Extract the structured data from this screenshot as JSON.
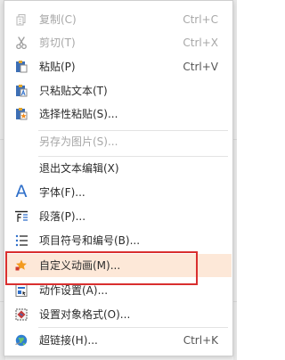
{
  "context_menu": {
    "items": [
      {
        "id": "copy",
        "label": "复制(C)",
        "shortcut": "Ctrl+C",
        "icon": "copy-icon",
        "enabled": false
      },
      {
        "id": "cut",
        "label": "剪切(T)",
        "shortcut": "Ctrl+X",
        "icon": "scissors-icon",
        "enabled": false
      },
      {
        "id": "paste",
        "label": "粘贴(P)",
        "shortcut": "Ctrl+V",
        "icon": "clipboard-paste-icon",
        "enabled": true
      },
      {
        "id": "paste-text-only",
        "label": "只粘贴文本(T)",
        "shortcut": "",
        "icon": "paste-text-icon",
        "enabled": true
      },
      {
        "id": "paste-special",
        "label": "选择性粘贴(S)...",
        "shortcut": "",
        "icon": "paste-special-icon",
        "enabled": true
      },
      {
        "id": "save-as-picture",
        "label": "另存为图片(S)...",
        "shortcut": "",
        "icon": "",
        "enabled": false
      },
      {
        "id": "exit-text-edit",
        "label": "退出文本编辑(X)",
        "shortcut": "",
        "icon": "",
        "enabled": true
      },
      {
        "id": "font",
        "label": "字体(F)...",
        "shortcut": "",
        "icon": "font-a-icon",
        "enabled": true
      },
      {
        "id": "paragraph",
        "label": "段落(P)...",
        "shortcut": "",
        "icon": "paragraph-icon",
        "enabled": true
      },
      {
        "id": "bullets-numbering",
        "label": "项目符号和编号(B)...",
        "shortcut": "",
        "icon": "bullet-list-icon",
        "enabled": true
      },
      {
        "id": "custom-animation",
        "label": "自定义动画(M)...",
        "shortcut": "",
        "icon": "star-animation-icon",
        "enabled": true,
        "highlighted": true
      },
      {
        "id": "action-settings",
        "label": "动作设置(A)...",
        "shortcut": "",
        "icon": "action-settings-icon",
        "enabled": true
      },
      {
        "id": "format-object",
        "label": "设置对象格式(O)...",
        "shortcut": "",
        "icon": "format-object-icon",
        "enabled": true
      },
      {
        "id": "hyperlink",
        "label": "超链接(H)...",
        "shortcut": "Ctrl+K",
        "icon": "hyperlink-globe-icon",
        "enabled": true
      }
    ]
  },
  "colors": {
    "highlight_background": "#fde8d8",
    "selection_box_border": "#d92f2f",
    "disabled_text": "#a7a7a7",
    "text": "#2b2b2b",
    "accent_blue": "#2d6ec9",
    "accent_orange": "#f28b1b"
  }
}
